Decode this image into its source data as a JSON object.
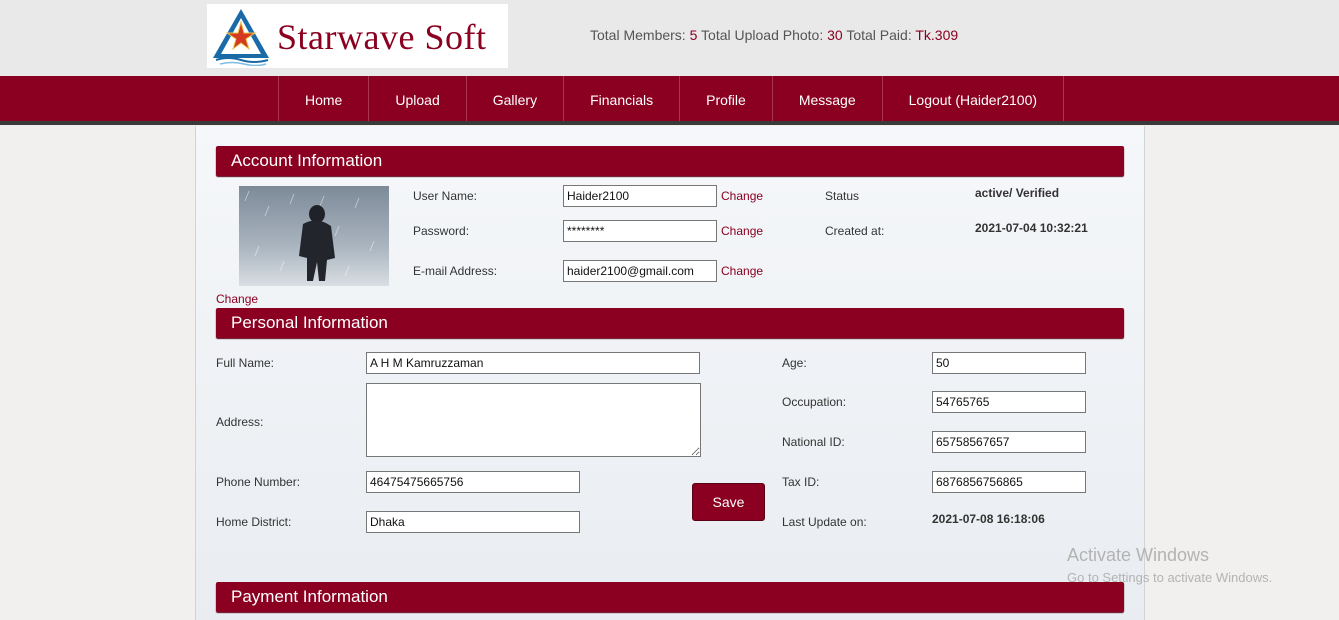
{
  "header": {
    "logo_text": "Starwave Soft",
    "stats": {
      "members_label": "Total Members:",
      "members_value": "5",
      "uploads_label": "Total Upload Photo:",
      "uploads_value": "30",
      "paid_label": "Total Paid:",
      "paid_value": "Tk.309"
    }
  },
  "nav": {
    "items": [
      "Home",
      "Upload",
      "Gallery",
      "Financials",
      "Profile",
      "Message",
      "Logout (Haider2100)"
    ]
  },
  "account": {
    "title": "Account Information",
    "photo_change": "Change",
    "username_label": "User Name:",
    "username_value": "Haider2100",
    "password_label": "Password:",
    "password_value": "********",
    "email_label": "E-mail Address:",
    "email_value": "haider2100@gmail.com",
    "change_label": "Change",
    "status_label": "Status",
    "status_value": "active/ Verified",
    "created_label": "Created at:",
    "created_value": "2021-07-04 10:32:21"
  },
  "personal": {
    "title": "Personal Information",
    "fullname_label": "Full Name:",
    "fullname_value": "A H M Kamruzzaman",
    "address_label": "Address:",
    "address_value": "",
    "phone_label": "Phone Number:",
    "phone_value": "46475475665756",
    "district_label": "Home District:",
    "district_value": "Dhaka",
    "save_label": "Save",
    "age_label": "Age:",
    "age_value": "50",
    "occupation_label": "Occupation:",
    "occupation_value": "54765765",
    "nid_label": "National ID:",
    "nid_value": "65758567657",
    "tax_label": "Tax ID:",
    "tax_value": "6876856756865",
    "lastupdate_label": "Last Update on:",
    "lastupdate_value": "2021-07-08 16:18:06"
  },
  "payment": {
    "title": "Payment Information"
  },
  "watermark": {
    "line1": "Activate Windows",
    "line2": "Go to Settings to activate Windows."
  },
  "colors": {
    "brand": "#8b0020",
    "nav_border": "#3a3a3a"
  }
}
